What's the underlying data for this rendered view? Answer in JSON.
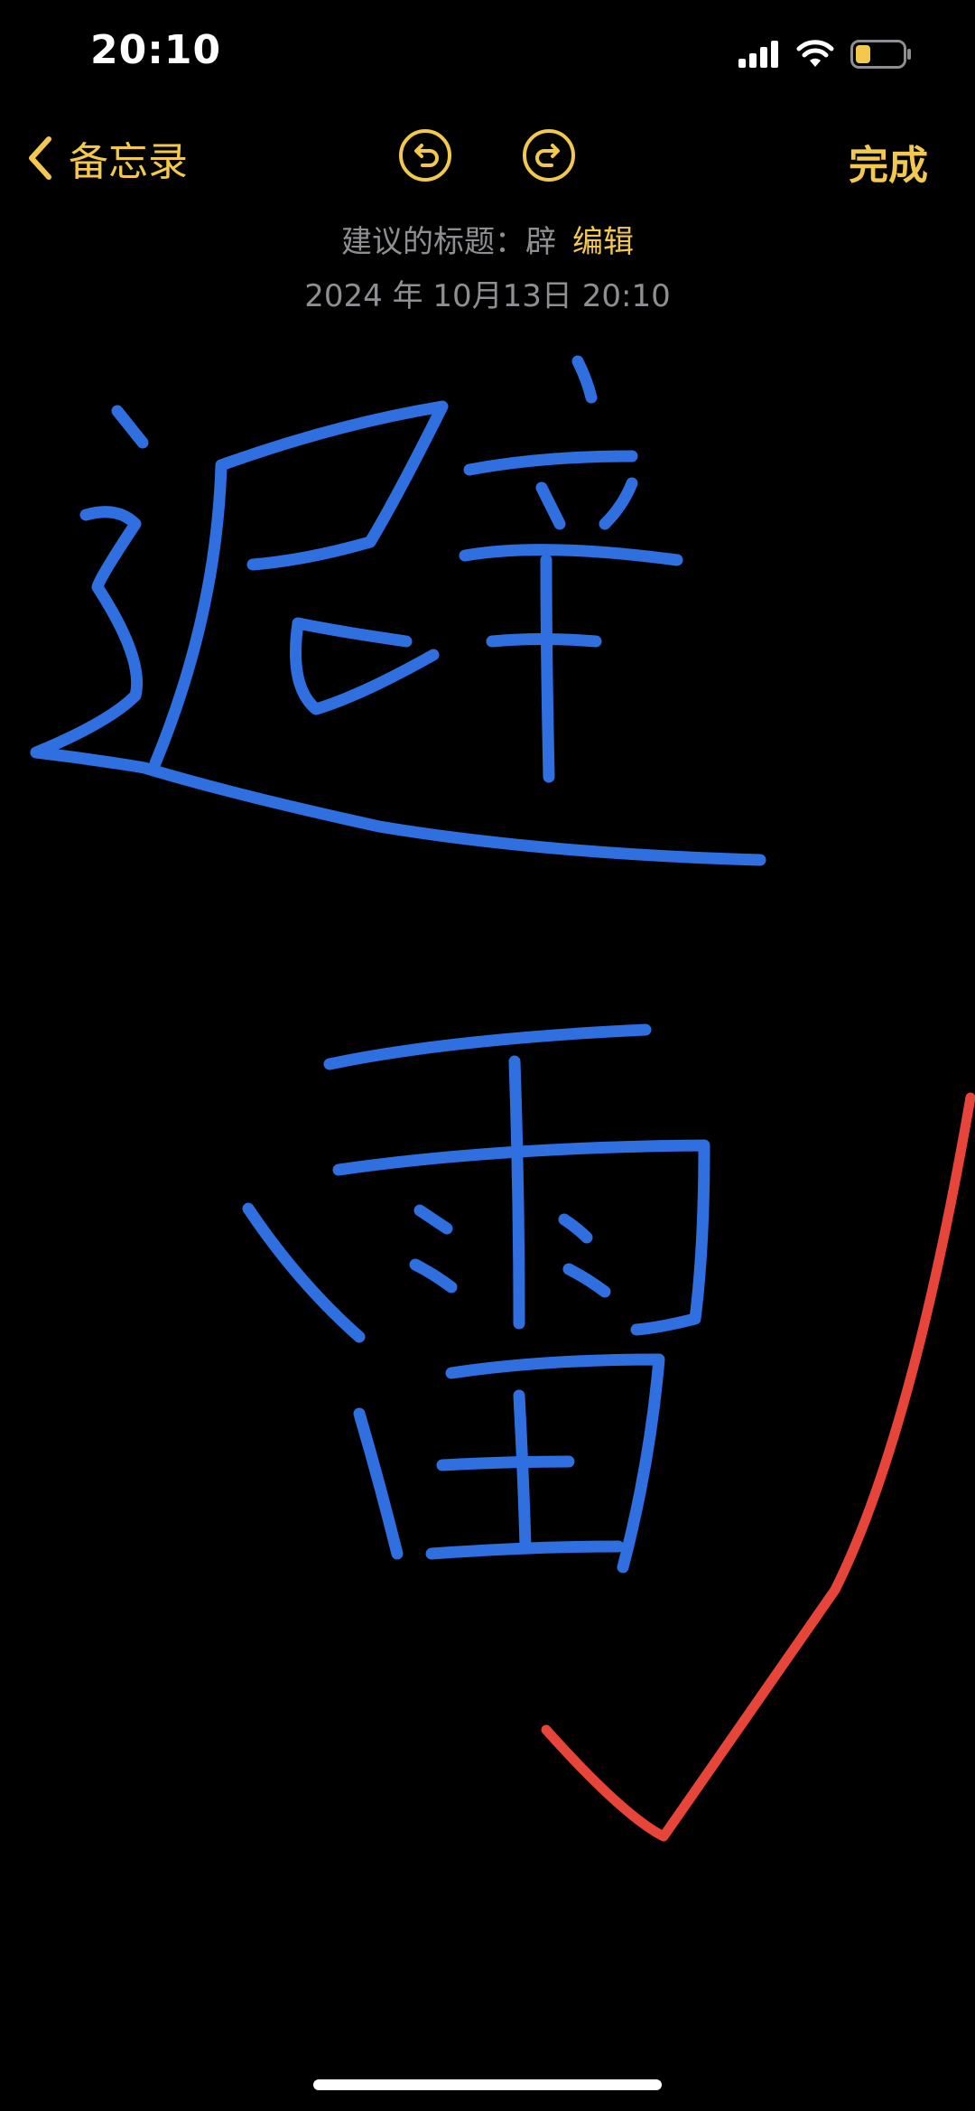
{
  "status_bar": {
    "time": "20:10",
    "icons": [
      "cellular-signal-icon",
      "wifi-icon",
      "battery-icon"
    ],
    "battery_color": "#f2c94c"
  },
  "nav": {
    "back_label": "备忘录",
    "undo_icon": "undo-icon",
    "redo_icon": "redo-icon",
    "done_label": "完成",
    "accent": "#f2c94c"
  },
  "note": {
    "suggested_title_label": "建议的标题：",
    "suggested_title_value": "辟",
    "edit_label": "编辑",
    "date": "2024 年 10月13日 20:10"
  },
  "canvas": {
    "content": [
      "避",
      "雷"
    ],
    "ink_colors": {
      "handwriting": "#2f6fe0",
      "checkmark": "#e8453a"
    }
  }
}
